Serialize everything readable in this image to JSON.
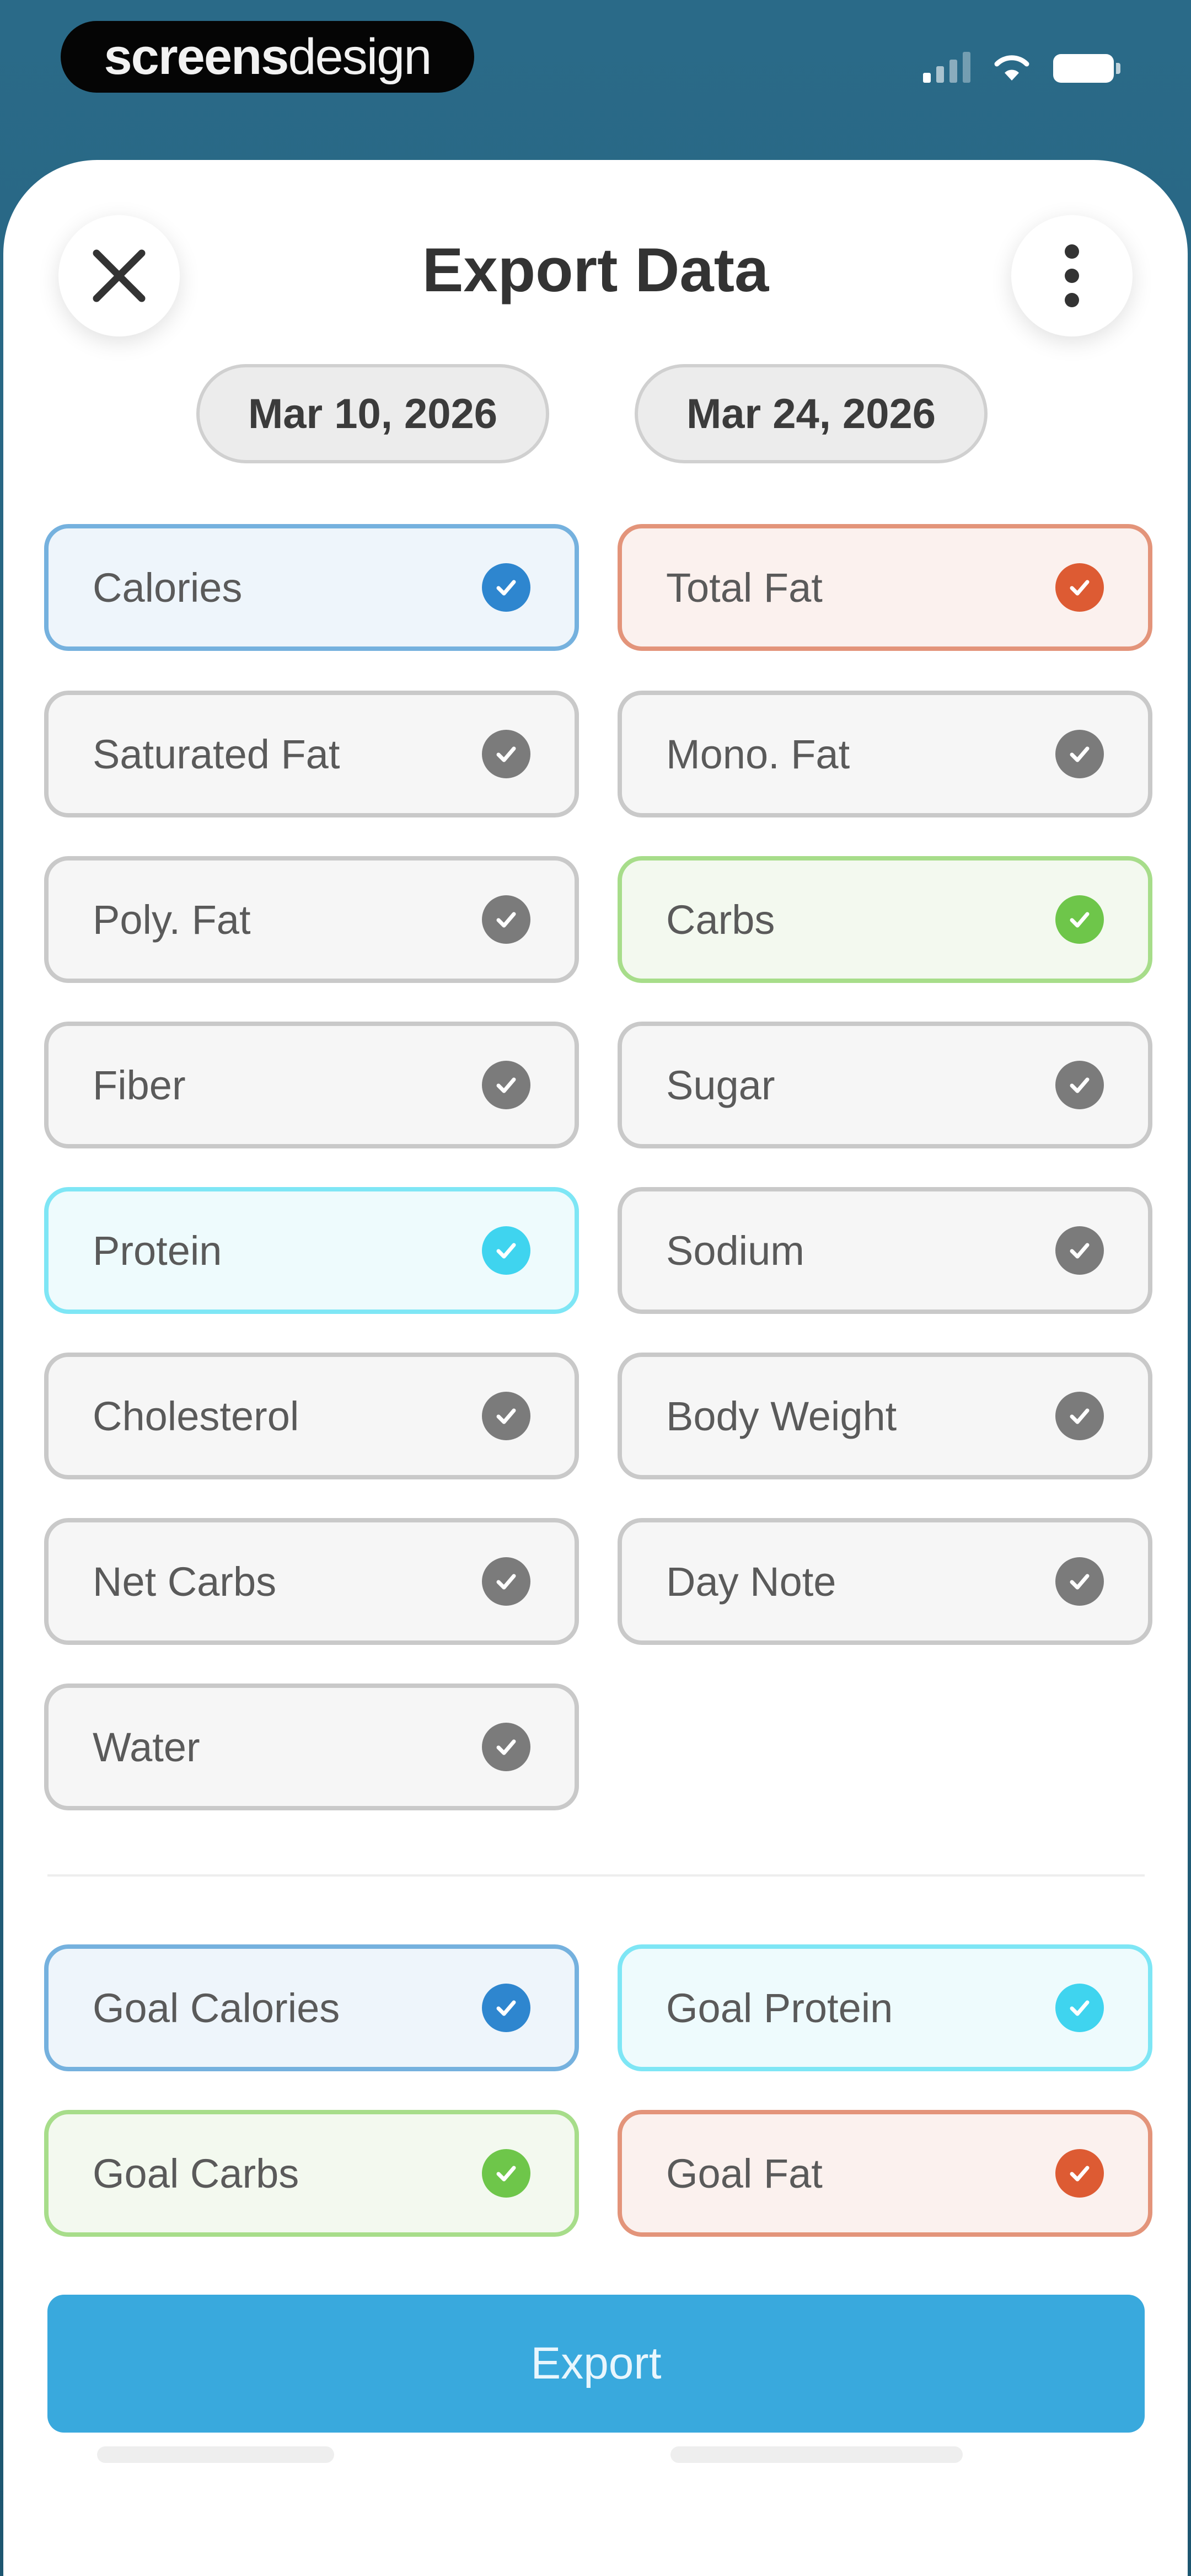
{
  "watermark": {
    "bold": "screens",
    "light": "design"
  },
  "header": {
    "title": "Export Data"
  },
  "date_range": {
    "start": "Mar 10, 2026",
    "end": "Mar 24, 2026"
  },
  "metrics": [
    {
      "label": "Calories",
      "state": "selected",
      "color": "#2e86cf"
    },
    {
      "label": "Total Fat",
      "state": "selected",
      "color": "#dd5b33"
    },
    {
      "label": "Saturated Fat",
      "state": "unselected"
    },
    {
      "label": "Mono. Fat",
      "state": "unselected"
    },
    {
      "label": "Poly. Fat",
      "state": "unselected"
    },
    {
      "label": "Carbs",
      "state": "selected",
      "color": "#6ec64a"
    },
    {
      "label": "Fiber",
      "state": "unselected"
    },
    {
      "label": "Sugar",
      "state": "unselected"
    },
    {
      "label": "Protein",
      "state": "selected",
      "color": "#3fd4ef"
    },
    {
      "label": "Sodium",
      "state": "unselected"
    },
    {
      "label": "Cholesterol",
      "state": "unselected"
    },
    {
      "label": "Body Weight",
      "state": "unselected"
    },
    {
      "label": "Net Carbs",
      "state": "unselected"
    },
    {
      "label": "Day Note",
      "state": "unselected"
    },
    {
      "label": "Water",
      "state": "unselected"
    }
  ],
  "goals": [
    {
      "label": "Goal Calories",
      "state": "selected",
      "color": "#2e86cf"
    },
    {
      "label": "Goal Protein",
      "state": "selected",
      "color": "#3fd4ef"
    },
    {
      "label": "Goal Carbs",
      "state": "selected",
      "color": "#6ec64a"
    },
    {
      "label": "Goal Fat",
      "state": "selected",
      "color": "#dd5b33"
    }
  ],
  "actions": {
    "export_label": "Export"
  },
  "icons": {
    "close": "close-icon",
    "more": "more-vertical-icon",
    "check": "checkmark-icon"
  }
}
